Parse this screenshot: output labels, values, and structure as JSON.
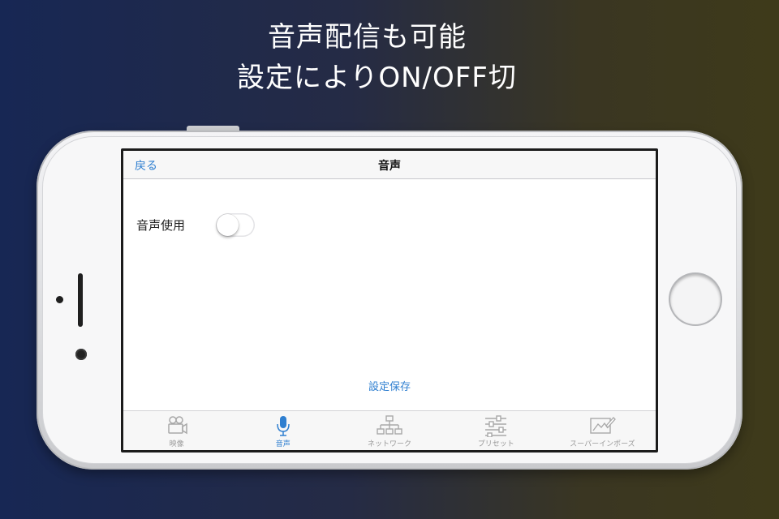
{
  "promo": {
    "line1": "音声配信も可能",
    "line2": "設定によりON/OFF切"
  },
  "navbar": {
    "back_label": "戻る",
    "title": "音声"
  },
  "settings": {
    "audio_use_label": "音声使用",
    "audio_use_enabled": false
  },
  "save_label": "設定保存",
  "tabs": [
    {
      "label": "映像",
      "icon": "video-camera-icon",
      "active": false
    },
    {
      "label": "音声",
      "icon": "microphone-icon",
      "active": true
    },
    {
      "label": "ネットワーク",
      "icon": "network-icon",
      "active": false
    },
    {
      "label": "プリセット",
      "icon": "sliders-icon",
      "active": false
    },
    {
      "label": "スーパーインポーズ",
      "icon": "superimpose-icon",
      "active": false
    }
  ],
  "colors": {
    "accent": "#2f7fd0",
    "tab_inactive": "#9a9a9a"
  }
}
